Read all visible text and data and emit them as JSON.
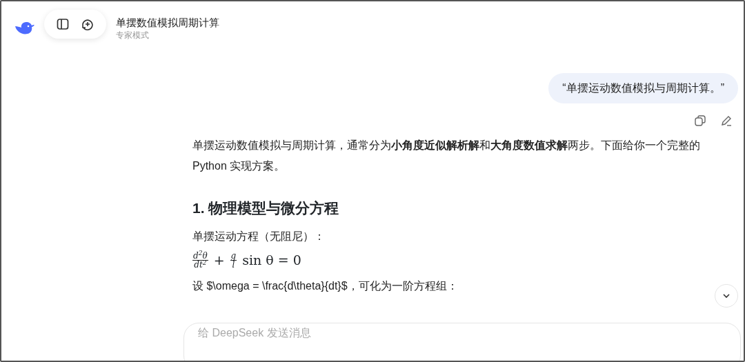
{
  "header": {
    "title": "单摆数值模拟周期计算",
    "subtitle": "专家模式"
  },
  "user_message": {
    "text": "“单摆运动数值模拟与周期计算。”"
  },
  "answer": {
    "intro": "单摆运动数值模拟与周期计算，通常分为**小角度近似解析解**和**大角度数值求解**两步。下面给你一个完整的 Python 实现方案。",
    "heading": "1. 物理模型与微分方程",
    "equation_label": "单摆运动方程（无阻尼）：",
    "formula": [
      {
        "kind": "frac",
        "num": "d$^{2}$θ",
        "den": "dt$^{2}$"
      },
      {
        "kind": "op",
        "text": "+"
      },
      {
        "kind": "frac",
        "num": "g",
        "den": "l"
      },
      {
        "kind": "text",
        "text": "sin θ = 0"
      }
    ],
    "next_line": "设 $\\omega = \\frac{d\\theta}{dt}$，可化为一阶方程组："
  },
  "composer": {
    "placeholder": "给 DeepSeek 发送消息"
  }
}
